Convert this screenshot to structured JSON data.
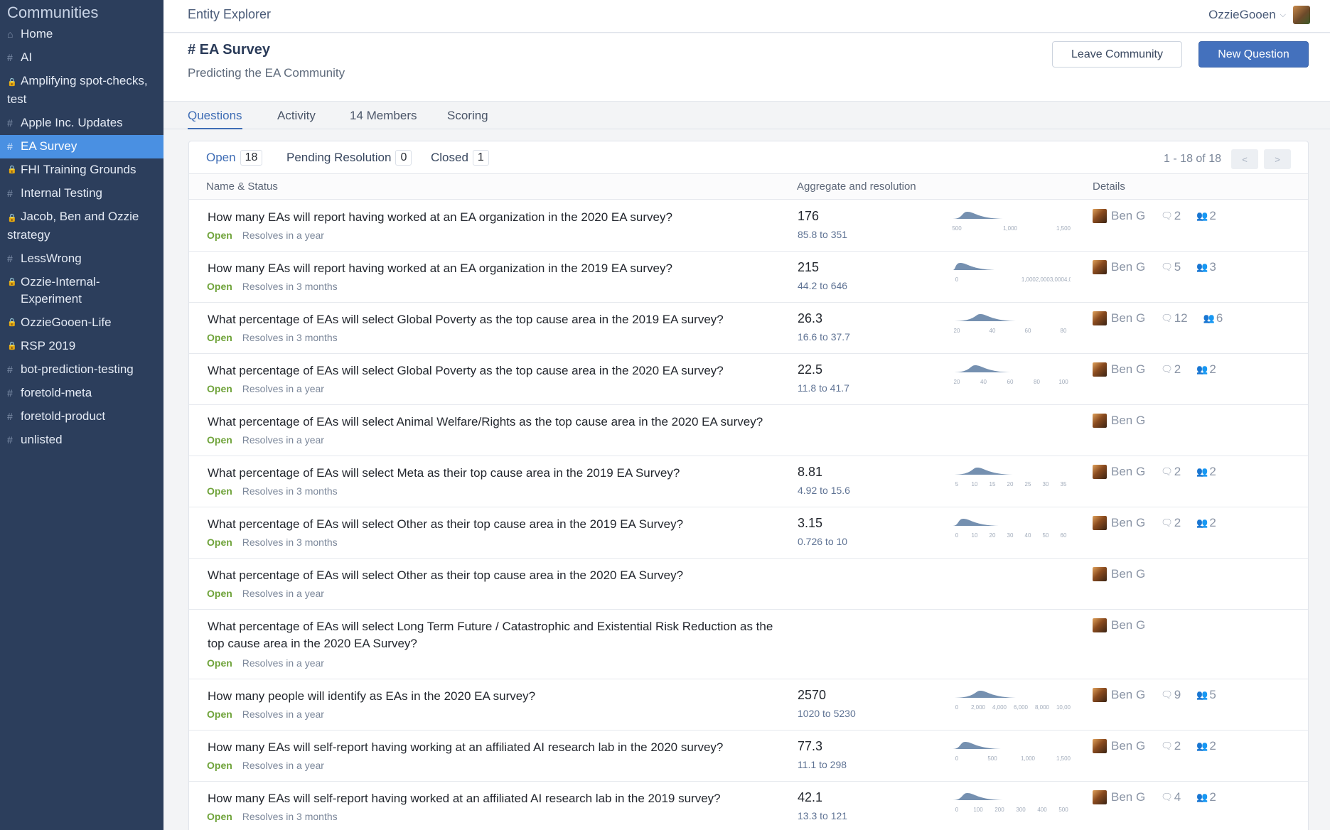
{
  "sidebar": {
    "title": "Communities",
    "items": [
      {
        "icon": "home-icon",
        "glyph": "⌂",
        "label": "Home"
      },
      {
        "icon": "hash-icon",
        "glyph": "#",
        "label": "AI"
      },
      {
        "icon": "lock-icon",
        "glyph": "🔒",
        "label": "Amplifying spot-checks, test"
      },
      {
        "icon": "hash-icon",
        "glyph": "#",
        "label": "Apple Inc. Updates"
      },
      {
        "icon": "hash-icon",
        "glyph": "#",
        "label": "EA Survey"
      },
      {
        "icon": "lock-icon",
        "glyph": "🔒",
        "label": "FHI Training Grounds"
      },
      {
        "icon": "hash-icon",
        "glyph": "#",
        "label": "Internal Testing"
      },
      {
        "icon": "lock-icon",
        "glyph": "🔒",
        "label": "Jacob, Ben and Ozzie strategy"
      },
      {
        "icon": "hash-icon",
        "glyph": "#",
        "label": "LessWrong"
      },
      {
        "icon": "lock-icon",
        "glyph": "🔒",
        "label": "Ozzie-Internal-Experiment"
      },
      {
        "icon": "lock-icon",
        "glyph": "🔒",
        "label": "OzzieGooen-Life"
      },
      {
        "icon": "lock-icon",
        "glyph": "🔒",
        "label": "RSP 2019"
      },
      {
        "icon": "hash-icon",
        "glyph": "#",
        "label": "bot-prediction-testing"
      },
      {
        "icon": "hash-icon",
        "glyph": "#",
        "label": "foretold-meta"
      },
      {
        "icon": "hash-icon",
        "glyph": "#",
        "label": "foretold-product"
      },
      {
        "icon": "hash-icon",
        "glyph": "#",
        "label": "unlisted"
      }
    ]
  },
  "topbar": {
    "title": "Entity Explorer",
    "user": "OzzieGooen"
  },
  "header": {
    "title": "# EA Survey",
    "subtitle": "Predicting the EA Community",
    "leave_label": "Leave Community",
    "new_label": "New Question"
  },
  "tabs": {
    "questions": "Questions",
    "activity": "Activity",
    "members": "14 Members",
    "scoring": "Scoring"
  },
  "filters": {
    "open_label": "Open",
    "open_count": "18",
    "pending_label": "Pending Resolution",
    "pending_count": "0",
    "closed_label": "Closed",
    "closed_count": "1",
    "pager_text": "1 - 18 of 18",
    "prev": "<",
    "next": ">"
  },
  "columns": {
    "name": "Name & Status",
    "aggregate": "Aggregate and resolution",
    "details": "Details"
  },
  "status_open": "Open",
  "author": "Ben G",
  "questions": [
    {
      "title": "How many EAs will report having worked at an EA organization in the 2020 EA survey?",
      "resolves": "Resolves in a year",
      "value": "176",
      "range": "85.8 to 351",
      "comments": "2",
      "members": "2",
      "ticks": [
        "500",
        "1,000",
        "1,500"
      ]
    },
    {
      "title": "How many EAs will report having worked at an EA organization in the 2019 EA survey?",
      "resolves": "Resolves in 3 months",
      "value": "215",
      "range": "44.2 to 646",
      "comments": "5",
      "members": "3",
      "ticks": [
        "0",
        "1,0002,0003,0004,0005,0006,00("
      ]
    },
    {
      "title": "What percentage of EAs will select Global Poverty as the top cause area in the 2019 EA survey?",
      "resolves": "Resolves in 3 months",
      "value": "26.3",
      "range": "16.6 to 37.7",
      "comments": "12",
      "members": "6",
      "ticks": [
        "20",
        "40",
        "60",
        "80"
      ]
    },
    {
      "title": "What percentage of EAs will select Global Poverty as the top cause area in the 2020 EA survey?",
      "resolves": "Resolves in a year",
      "value": "22.5",
      "range": "11.8 to 41.7",
      "comments": "2",
      "members": "2",
      "ticks": [
        "20",
        "40",
        "60",
        "80",
        "100"
      ]
    },
    {
      "title": "What percentage of EAs will select Animal Welfare/Rights as the top cause area in the 2020 EA survey?",
      "resolves": "Resolves in a year",
      "value": "",
      "range": "",
      "comments": "",
      "members": "",
      "ticks": []
    },
    {
      "title": "What percentage of EAs will select Meta as their top cause area in the 2019 EA Survey?",
      "resolves": "Resolves in 3 months",
      "value": "8.81",
      "range": "4.92 to 15.6",
      "comments": "2",
      "members": "2",
      "ticks": [
        "5",
        "10",
        "15",
        "20",
        "25",
        "30",
        "35"
      ]
    },
    {
      "title": "What percentage of EAs will select Other as their top cause area in the 2019 EA Survey?",
      "resolves": "Resolves in 3 months",
      "value": "3.15",
      "range": "0.726 to 10",
      "comments": "2",
      "members": "2",
      "ticks": [
        "0",
        "10",
        "20",
        "30",
        "40",
        "50",
        "60"
      ]
    },
    {
      "title": "What percentage of EAs will select Other as their top cause area in the 2020 EA Survey?",
      "resolves": "Resolves in a year",
      "value": "",
      "range": "",
      "comments": "",
      "members": "",
      "ticks": []
    },
    {
      "title": "What percentage of EAs will select Long Term Future / Catastrophic and Existential Risk Reduction as the top cause area in the 2020 EA Survey?",
      "resolves": "Resolves in a year",
      "value": "",
      "range": "",
      "comments": "",
      "members": "",
      "ticks": []
    },
    {
      "title": "How many people will identify as EAs in the 2020 EA survey?",
      "resolves": "Resolves in a year",
      "value": "2570",
      "range": "1020 to 5230",
      "comments": "9",
      "members": "5",
      "ticks": [
        "0",
        "2,000",
        "4,000",
        "6,000",
        "8,000",
        "10,00"
      ]
    },
    {
      "title": "How many EAs will self-report having working at an affiliated AI research lab in the 2020 survey?",
      "resolves": "Resolves in a year",
      "value": "77.3",
      "range": "11.1 to 298",
      "comments": "2",
      "members": "2",
      "ticks": [
        "0",
        "500",
        "1,000",
        "1,500"
      ]
    },
    {
      "title": "How many EAs will self-report having worked at an affiliated AI research lab in the 2019 survey?",
      "resolves": "Resolves in 3 months",
      "value": "42.1",
      "range": "13.3 to 121",
      "comments": "4",
      "members": "2",
      "ticks": [
        "0",
        "100",
        "200",
        "300",
        "400",
        "500"
      ]
    }
  ]
}
